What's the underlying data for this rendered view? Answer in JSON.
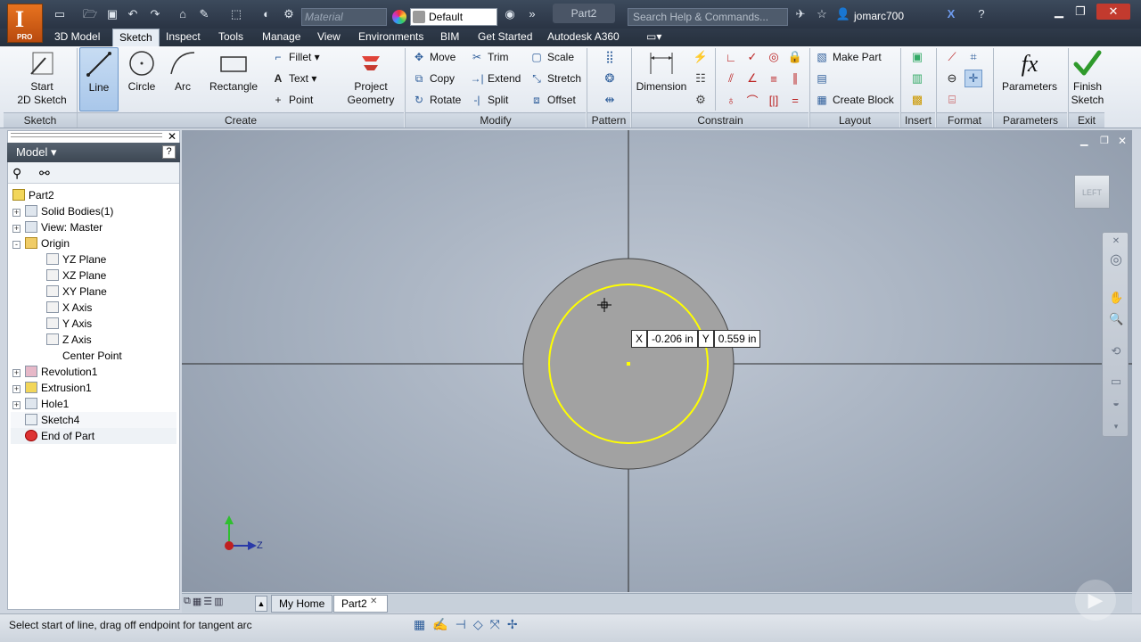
{
  "app": {
    "logo_letter": "I",
    "logo_edition": "PRO"
  },
  "titlebar": {
    "material_placeholder": "Material",
    "appearance_value": "Default",
    "document_title": "Part2",
    "search_placeholder": "Search Help & Commands...",
    "user_name": "jomarc700"
  },
  "tabs": [
    "3D Model",
    "Sketch",
    "Inspect",
    "Tools",
    "Manage",
    "View",
    "Environments",
    "BIM",
    "Get Started",
    "Autodesk A360"
  ],
  "ribbon": {
    "sketch_panel": {
      "label": "Sketch",
      "start_sketch": "Start",
      "start_sketch2": "2D Sketch"
    },
    "create_panel": {
      "label": "Create",
      "line": "Line",
      "circle": "Circle",
      "arc": "Arc",
      "rectangle": "Rectangle",
      "fillet": "Fillet",
      "text": "Text",
      "point": "Point",
      "project_geometry": "Project",
      "project_geometry2": "Geometry"
    },
    "modify_panel": {
      "label": "Modify",
      "move": "Move",
      "trim": "Trim",
      "scale": "Scale",
      "copy": "Copy",
      "extend": "Extend",
      "stretch": "Stretch",
      "rotate": "Rotate",
      "split": "Split",
      "offset": "Offset"
    },
    "pattern_panel": {
      "label": "Pattern"
    },
    "constrain_panel": {
      "label": "Constrain",
      "dimension": "Dimension"
    },
    "layout_panel": {
      "label": "Layout",
      "make_part": "Make Part",
      "create_block": "Create Block"
    },
    "insert_panel": {
      "label": "Insert"
    },
    "format_panel": {
      "label": "Format"
    },
    "parameters_panel": {
      "label": "Parameters",
      "parameters": "Parameters"
    },
    "exit_panel": {
      "label": "Exit",
      "finish": "Finish",
      "finish2": "Sketch"
    }
  },
  "browser": {
    "title": "Model",
    "tree": [
      {
        "label": "Part2",
        "level": 0,
        "expander": ""
      },
      {
        "label": "Solid Bodies(1)",
        "level": 1,
        "expander": "+"
      },
      {
        "label": "View: Master",
        "level": 1,
        "expander": "+"
      },
      {
        "label": "Origin",
        "level": 1,
        "expander": "-"
      },
      {
        "label": "YZ Plane",
        "level": 2,
        "expander": ""
      },
      {
        "label": "XZ Plane",
        "level": 2,
        "expander": ""
      },
      {
        "label": "XY Plane",
        "level": 2,
        "expander": ""
      },
      {
        "label": "X Axis",
        "level": 2,
        "expander": ""
      },
      {
        "label": "Y Axis",
        "level": 2,
        "expander": ""
      },
      {
        "label": "Z Axis",
        "level": 2,
        "expander": ""
      },
      {
        "label": "Center Point",
        "level": 2,
        "expander": ""
      },
      {
        "label": "Revolution1",
        "level": 1,
        "expander": "+"
      },
      {
        "label": "Extrusion1",
        "level": 1,
        "expander": "+"
      },
      {
        "label": "Hole1",
        "level": 1,
        "expander": "+"
      },
      {
        "label": "Sketch4",
        "level": 1,
        "expander": ""
      },
      {
        "label": "End of Part",
        "level": 1,
        "expander": ""
      }
    ]
  },
  "viewport": {
    "viewcube_label": "LEFT",
    "coord_x_label": "X",
    "coord_x_value": "-0.206 in",
    "coord_y_label": "Y",
    "coord_y_value": "0.559 in",
    "axis_z_label": "Z",
    "sketch_color": "#ffff00"
  },
  "doc_tabs": [
    "My Home",
    "Part2"
  ],
  "status": {
    "message": "Select start of line, drag off endpoint for tangent arc"
  }
}
